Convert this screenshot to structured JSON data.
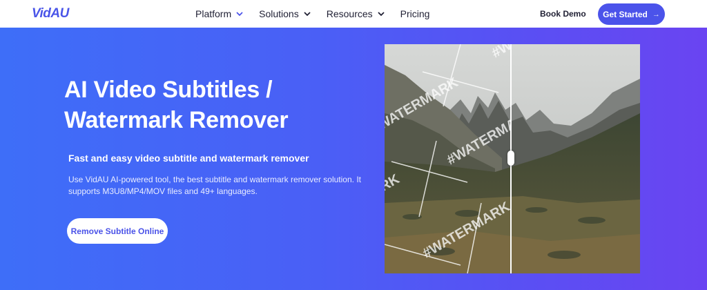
{
  "brand": {
    "name": "VidAU",
    "accent": "#4b53ea"
  },
  "nav": {
    "items": [
      {
        "label": "Platform",
        "has_dropdown": true,
        "active": true
      },
      {
        "label": "Solutions",
        "has_dropdown": true
      },
      {
        "label": "Resources",
        "has_dropdown": true
      },
      {
        "label": "Pricing",
        "has_dropdown": false
      }
    ],
    "book_demo": "Book Demo",
    "get_started": "Get Started"
  },
  "hero": {
    "title_line1": "AI Video Subtitles /",
    "title_line2": "Watermark Remover",
    "subtitle": "Fast and easy video subtitle and watermark remover",
    "description": "Use VidAU AI-powered tool, the best subtitle and watermark remover solution. It supports M3U8/MP4/MOV files and 49+ languages.",
    "cta": "Remove Subtitle Online",
    "gradient": [
      "#3e6ef8",
      "#6a44f2"
    ]
  },
  "compare": {
    "watermark_text": "#WATERMARK",
    "handle_icon": "slider-handle-icon"
  }
}
